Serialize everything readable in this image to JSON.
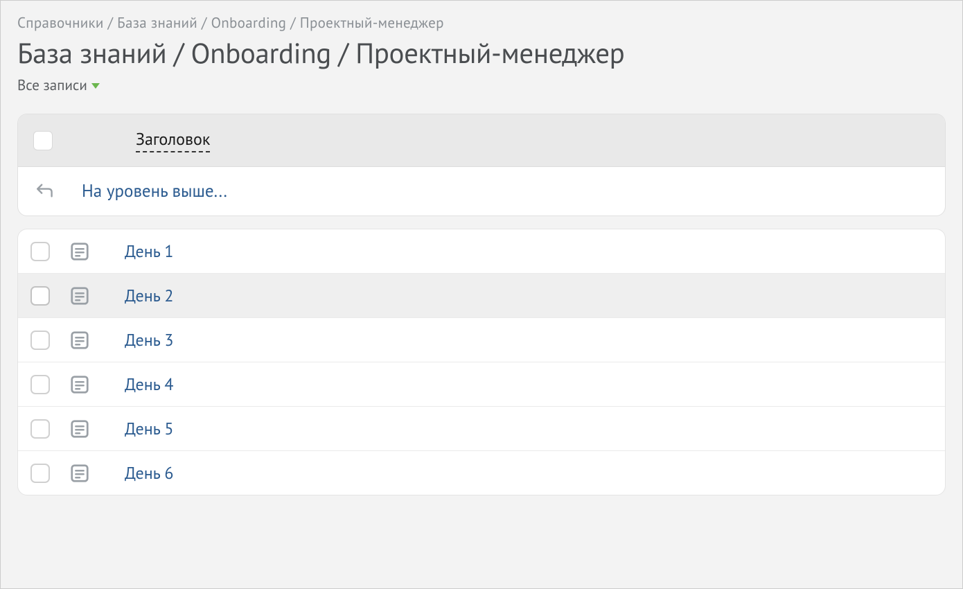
{
  "breadcrumb": "Справочники / База знаний / Onboarding / Проектный-менеджер",
  "page_title": "База знаний / Onboarding / Проектный-менеджер",
  "filter_label": "Все записи",
  "table_header": {
    "title_col": "Заголовок"
  },
  "up_link": "На уровень выше...",
  "rows": [
    {
      "label": "День 1"
    },
    {
      "label": "День 2"
    },
    {
      "label": "День 3"
    },
    {
      "label": "День 4"
    },
    {
      "label": "День 5"
    },
    {
      "label": "День 6"
    }
  ]
}
